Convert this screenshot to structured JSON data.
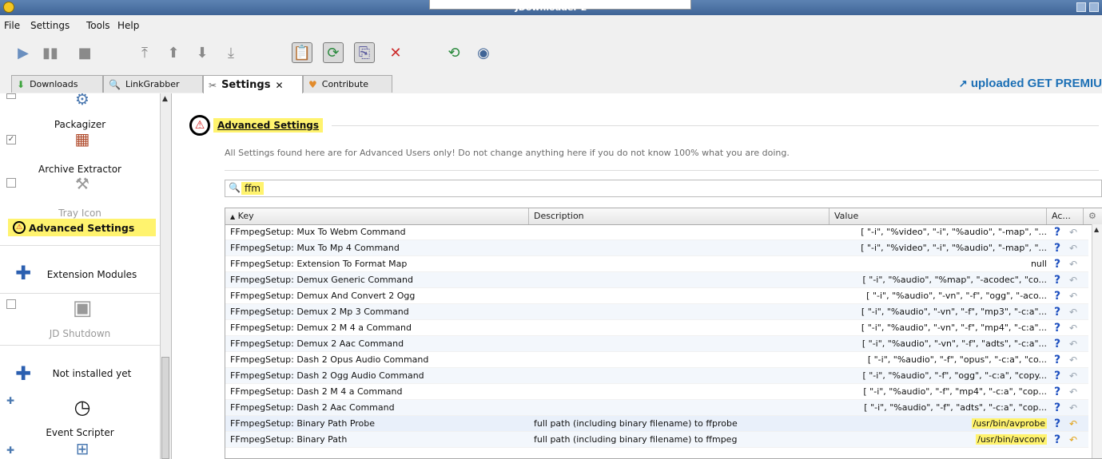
{
  "window": {
    "title": "JDownloader 2"
  },
  "menu": {
    "file": "File",
    "settings": "Settings",
    "tools": "Tools",
    "help": "Help"
  },
  "tabs": [
    {
      "label": "Downloads"
    },
    {
      "label": "LinkGrabber"
    },
    {
      "label": "Settings",
      "close": "✕"
    },
    {
      "label": "Contribute"
    }
  ],
  "brand": {
    "logo": "uploaded",
    "premium": "GET PREMIU"
  },
  "sidebar": {
    "items": [
      {
        "label": "Packagizer"
      },
      {
        "label": "Archive Extractor"
      },
      {
        "label": "Tray Icon"
      },
      {
        "label": "Advanced Settings"
      },
      {
        "label": "Extension Modules"
      },
      {
        "label": "JD Shutdown"
      },
      {
        "label": "Not installed yet"
      },
      {
        "label": "Event Scripter"
      }
    ]
  },
  "main": {
    "title": "Advanced Settings",
    "description": "All Settings found here are for Advanced Users only! Do not change anything here if you do not know 100% what you are doing.",
    "search_value": "ffm",
    "table": {
      "headers": {
        "key": "Key",
        "description": "Description",
        "value": "Value",
        "actions": "Ac..."
      },
      "rows": [
        {
          "key": "FFmpegSetup: Mux To Webm Command",
          "desc": "",
          "value": "[ \"-i\", \"%video\", \"-i\", \"%audio\", \"-map\", \"..."
        },
        {
          "key": "FFmpegSetup: Mux To Mp 4 Command",
          "desc": "",
          "value": "[ \"-i\", \"%video\", \"-i\", \"%audio\", \"-map\", \"..."
        },
        {
          "key": "FFmpegSetup: Extension To Format Map",
          "desc": "",
          "value": "null"
        },
        {
          "key": "FFmpegSetup: Demux Generic Command",
          "desc": "",
          "value": "[ \"-i\", \"%audio\", \"%map\", \"-acodec\", \"co..."
        },
        {
          "key": "FFmpegSetup: Demux And Convert 2 Ogg",
          "desc": "",
          "value": "[ \"-i\", \"%audio\", \"-vn\", \"-f\", \"ogg\", \"-aco..."
        },
        {
          "key": "FFmpegSetup: Demux 2 Mp 3 Command",
          "desc": "",
          "value": "[ \"-i\", \"%audio\", \"-vn\", \"-f\", \"mp3\", \"-c:a\"..."
        },
        {
          "key": "FFmpegSetup: Demux 2 M 4 a Command",
          "desc": "",
          "value": "[ \"-i\", \"%audio\", \"-vn\", \"-f\", \"mp4\", \"-c:a\"..."
        },
        {
          "key": "FFmpegSetup: Demux 2 Aac Command",
          "desc": "",
          "value": "[ \"-i\", \"%audio\", \"-vn\", \"-f\", \"adts\", \"-c:a\"..."
        },
        {
          "key": "FFmpegSetup: Dash 2 Opus Audio Command",
          "desc": "",
          "value": "[ \"-i\", \"%audio\", \"-f\", \"opus\", \"-c:a\", \"co..."
        },
        {
          "key": "FFmpegSetup: Dash 2 Ogg Audio Command",
          "desc": "",
          "value": "[ \"-i\", \"%audio\", \"-f\", \"ogg\", \"-c:a\", \"copy..."
        },
        {
          "key": "FFmpegSetup: Dash 2 M 4 a Command",
          "desc": "",
          "value": "[ \"-i\", \"%audio\", \"-f\", \"mp4\", \"-c:a\", \"cop..."
        },
        {
          "key": "FFmpegSetup: Dash 2 Aac Command",
          "desc": "",
          "value": "[ \"-i\", \"%audio\", \"-f\", \"adts\", \"-c:a\", \"cop..."
        },
        {
          "key": "FFmpegSetup: Binary Path Probe",
          "desc": "full path (including binary filename) to ffprobe",
          "value": "/usr/bin/avprobe"
        },
        {
          "key": "FFmpegSetup: Binary Path",
          "desc": "full path (including binary filename) to ffmpeg",
          "value": "/usr/bin/avconv"
        }
      ]
    }
  },
  "icons": {
    "help": "?",
    "undo": "↶",
    "warning": "⚠"
  },
  "colors": {
    "highlight": "#fff36e",
    "accent": "#1b6fb5"
  }
}
